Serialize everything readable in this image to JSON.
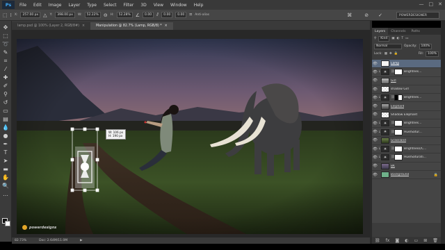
{
  "app": {
    "logo": "Ps"
  },
  "menu": [
    "File",
    "Edit",
    "Image",
    "Layer",
    "Type",
    "Select",
    "Filter",
    "3D",
    "View",
    "Window",
    "Help"
  ],
  "window_controls": {
    "minimize": "—",
    "maximize": "□",
    "close": "✕"
  },
  "options": {
    "x_label": "X:",
    "x_value": "257.00 px",
    "y_label": "Y:",
    "y_value": "398.00 px",
    "w_label": "W:",
    "w_value": "52.22%",
    "h_label": "H:",
    "h_value": "52.28%",
    "rotate_value": "0.00",
    "h_skew": "0.00",
    "v_skew": "0.00",
    "antialias": "Anti-alias",
    "workspace": "POWERDESIGNER"
  },
  "tabs": [
    {
      "label": "lamp.psd @ 100% (Layer 2, RGB/8#)",
      "active": false,
      "close": "×"
    },
    {
      "label": "Manipulation @ 82.7% (Lamp, RGB/8) *",
      "active": true,
      "close": "×"
    }
  ],
  "canvas": {
    "tooltip_w": "W: 106 px",
    "tooltip_h": "H: 190 px",
    "watermark": "powerdesigns"
  },
  "status": {
    "zoom": "82.73%",
    "doc": "Doc: 2.64M/11.0M",
    "arrow": "▶"
  },
  "layers_panel": {
    "tabs": [
      "Layers",
      "Channels",
      "Paths"
    ],
    "kind": "Kind",
    "blend_mode": "Normal",
    "opacity_label": "Opacity:",
    "opacity_value": "100%",
    "lock_label": "Lock:",
    "fill_label": "Fill:",
    "fill_value": "100%",
    "layers": [
      {
        "name": "Lamp",
        "selected": true,
        "type": "smart",
        "indent": false
      },
      {
        "name": "Brightnes...",
        "selected": false,
        "type": "adjust",
        "indent": true
      },
      {
        "name": "Girl",
        "selected": false,
        "type": "girl",
        "indent": false
      },
      {
        "name": "shadow Girl",
        "selected": false,
        "type": "blank",
        "indent": false
      },
      {
        "name": "Brightnes...",
        "selected": false,
        "type": "adjust-mask",
        "indent": true
      },
      {
        "name": "Elephant",
        "selected": false,
        "type": "elephant",
        "indent": false
      },
      {
        "name": "Shadow Elephant",
        "selected": false,
        "type": "blank",
        "indent": false
      },
      {
        "name": "Brightnes...",
        "selected": false,
        "type": "adjust",
        "indent": true
      },
      {
        "name": "Hue/Satur...",
        "selected": false,
        "type": "adjust",
        "indent": true
      },
      {
        "name": "Grassland",
        "selected": false,
        "type": "grass",
        "indent": false
      },
      {
        "name": "Brightness/C...",
        "selected": false,
        "type": "adjust",
        "indent": true
      },
      {
        "name": "Hue/Saturati...",
        "selected": false,
        "type": "adjust",
        "indent": true
      },
      {
        "name": "BK",
        "selected": false,
        "type": "sky",
        "indent": false
      },
      {
        "name": "Background",
        "selected": false,
        "type": "bg",
        "indent": false
      }
    ],
    "footer_icons": [
      "link-icon",
      "fx-icon",
      "mask-icon",
      "adjust-icon",
      "folder-icon",
      "new-layer-icon",
      "trash-icon"
    ]
  },
  "colors": {
    "selected_layer": "#5a6a80",
    "background_swatch": "#6fb08a",
    "app_dark": "#393939"
  }
}
